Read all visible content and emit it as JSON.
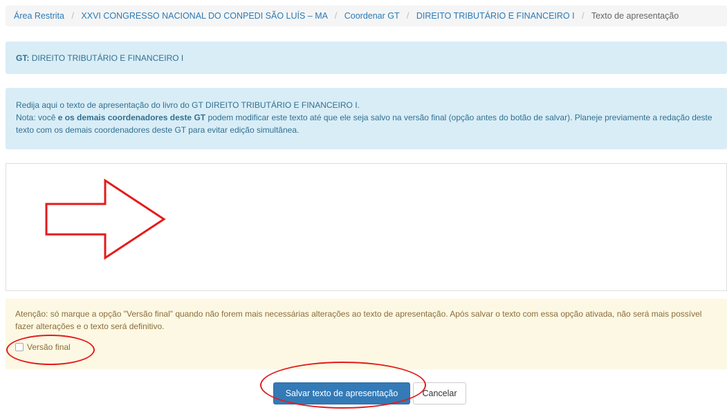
{
  "breadcrumb": {
    "items": [
      "Área Restrita",
      "XXVI CONGRESSO NACIONAL DO CONPEDI SÃO LUÍS – MA",
      "Coordenar GT",
      "DIREITO TRIBUTÁRIO E FINANCEIRO I"
    ],
    "separator": "/",
    "current": "Texto de apresentação"
  },
  "gt_box": {
    "label": "GT:",
    "value": "DIREITO TRIBUTÁRIO E FINANCEIRO I"
  },
  "description": {
    "line1": "Redija aqui o texto de apresentação do livro do GT DIREITO TRIBUTÁRIO E FINANCEIRO I.",
    "note_prefix": "Nota: você ",
    "note_bold": "e os demais coordenadores deste GT",
    "note_suffix": " podem modificar este texto até que ele seja salvo na versão final (opção antes do botão de salvar). Planeje previamente a redação deste texto com os demais coordenadores deste GT para evitar edição simultânea."
  },
  "editor": {
    "content": ""
  },
  "warning": {
    "text": "Atenção: só marque a opção \"Versão final\" quando não forem mais necessárias alterações ao texto de apresentação. Após salvar o texto com essa opção ativada, não será mais possível fazer alterações e o texto será definitivo.",
    "checkbox_label": "Versão final",
    "checkbox_checked": false
  },
  "actions": {
    "save_label": "Salvar texto de apresentação",
    "cancel_label": "Cancelar"
  },
  "annotation_colors": {
    "arrow": "#e41b1b",
    "ovals": "#e41b1b"
  },
  "annotation_icon": "right-arrow-outline-icon"
}
